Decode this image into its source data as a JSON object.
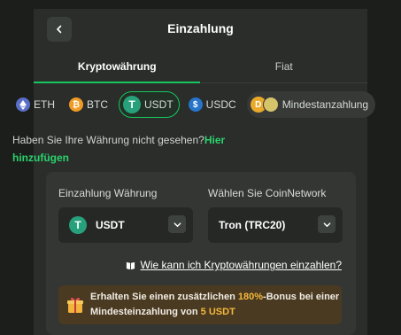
{
  "header": {
    "title": "Einzahlung"
  },
  "tabs": [
    {
      "label": "Kryptowährung",
      "active": true
    },
    {
      "label": "Fiat",
      "active": false
    }
  ],
  "coins": [
    {
      "label": "ETH",
      "icon": "eth-icon"
    },
    {
      "label": "BTC",
      "icon": "btc-icon"
    },
    {
      "label": "USDT",
      "icon": "usdt-icon",
      "selected": true
    },
    {
      "label": "USDC",
      "icon": "usdc-icon"
    },
    {
      "label": "Mindestanzahlung",
      "icon": "multi-coin-icon"
    }
  ],
  "notice": {
    "text": "Haben Sie Ihre Währung nicht gesehen?",
    "link": "Hier hinzufügen"
  },
  "form": {
    "currency_label": "Einzahlung Währung",
    "currency_value": "USDT",
    "network_label": "Wählen Sie CoinNetwork",
    "network_value": "Tron (TRC20)"
  },
  "help_link": "Wie kann ich Kryptowährungen einzahlen?",
  "promo": {
    "part1": "Erhalten Sie einen zusätzlichen ",
    "percent": "180%",
    "part2": "-Bonus bei einer Mindesteinzahlung von ",
    "amount": "5 USDT"
  },
  "colors": {
    "accent": "#18c65f",
    "background": "#1c1e1c",
    "panel": "#2a2d2a",
    "promo_highlight": "#f5b83b"
  }
}
